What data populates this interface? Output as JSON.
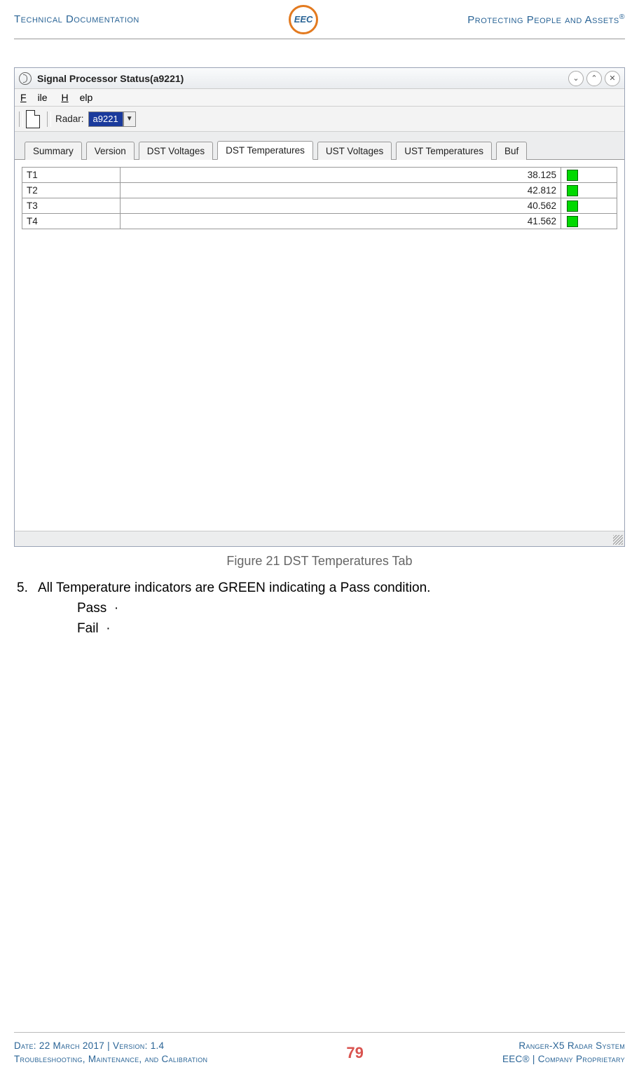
{
  "header": {
    "left": "Technical Documentation",
    "logo_text": "EEC",
    "right_prefix": "Protecting People and Assets",
    "right_trademark": "®"
  },
  "app": {
    "title": "Signal Processor Status(a9221)",
    "menu": {
      "file": "File",
      "file_u": "F",
      "help": "Help",
      "help_u": "H"
    },
    "toolbar": {
      "radar_label": "Radar:",
      "radar_value": "a9221"
    },
    "tabs": [
      "Summary",
      "Version",
      "DST Voltages",
      "DST Temperatures",
      "UST Voltages",
      "UST Temperatures",
      "Buf"
    ],
    "active_tab_index": 3,
    "rows": [
      {
        "name": "T1",
        "value": "38.125"
      },
      {
        "name": "T2",
        "value": "42.812"
      },
      {
        "name": "T3",
        "value": "40.562"
      },
      {
        "name": "T4",
        "value": "41.562"
      }
    ]
  },
  "figure_caption": "Figure 21 DST Temperatures Tab",
  "step": {
    "number": "5.",
    "text": "All Temperature indicators are GREEN indicating a Pass condition.",
    "pass": "Pass",
    "fail": "Fail",
    "dot": "·"
  },
  "footer": {
    "left_line1": "Date: 22 March 2017 | Version: 1.4",
    "left_line2": "Troubleshooting, Maintenance, and Calibration",
    "page_number": "79",
    "right_line1": "Ranger-X5 Radar System",
    "right_line2": "EEC® | Company Proprietary"
  }
}
